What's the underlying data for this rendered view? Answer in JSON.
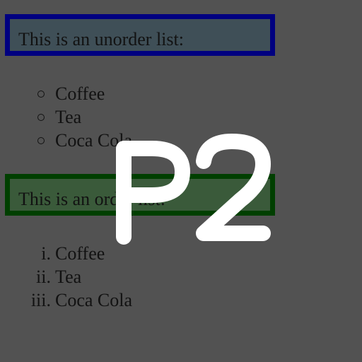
{
  "page": {
    "background": "#525252"
  },
  "unordered_section": {
    "heading": "This is an unorder list:",
    "border_color": "#000080",
    "background_color": "#3f4f57",
    "bullet_style": "circle",
    "items": [
      "Coffee",
      "Tea",
      "Coca Cola"
    ]
  },
  "ordered_section": {
    "heading": "This is an order list:",
    "border_color": "#003f00",
    "background_color": "#3a5a3a",
    "numbering_style": "lower-roman",
    "markers": [
      "i.",
      "ii.",
      "iii."
    ],
    "items": [
      "Coffee",
      "Tea",
      "Coca Cola"
    ]
  },
  "overlay": {
    "text": "P2",
    "color": "#ffffff"
  }
}
